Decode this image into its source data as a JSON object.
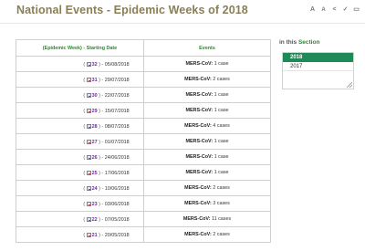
{
  "page": {
    "title": "National Events - Epidemic Weeks of 2018"
  },
  "toolbar": {
    "tools": [
      {
        "icon": "increase-font-icon",
        "glyph": "A"
      },
      {
        "icon": "decrease-font-icon",
        "glyph": "A"
      },
      {
        "icon": "share-icon",
        "glyph": "<"
      },
      {
        "icon": "send-icon",
        "glyph": "✓"
      },
      {
        "icon": "print-icon",
        "glyph": "▭"
      }
    ]
  },
  "table": {
    "headers": {
      "week": "(Epidemic Week) - Starting Date",
      "events": "Events"
    },
    "rows": [
      {
        "week": "32",
        "date": "05/08/2018",
        "event_name": "MERS-CoV",
        "event_count": "1 case"
      },
      {
        "week": "31",
        "date": "29/07/2018",
        "event_name": "MERS-CoV",
        "event_count": "2 cases"
      },
      {
        "week": "30",
        "date": "22/07/2018",
        "event_name": "MERS-CoV",
        "event_count": "1 case"
      },
      {
        "week": "29",
        "date": "15/07/2018",
        "event_name": "MERS-CoV",
        "event_count": "1 case"
      },
      {
        "week": "28",
        "date": "08/07/2018",
        "event_name": "MERS-CoV",
        "event_count": "4 cases"
      },
      {
        "week": "27",
        "date": "01/07/2018",
        "event_name": "MERS-CoV",
        "event_count": "1 case"
      },
      {
        "week": "26",
        "date": "24/06/2018",
        "event_name": "MERS-CoV",
        "event_count": "1 case"
      },
      {
        "week": "25",
        "date": "17/06/2018",
        "event_name": "MERS-CoV",
        "event_count": "1 case"
      },
      {
        "week": "24",
        "date": "10/06/2018",
        "event_name": "MERS-CoV",
        "event_count": "2 cases"
      },
      {
        "week": "23",
        "date": "03/06/2018",
        "event_name": "MERS-CoV",
        "event_count": "3 cases"
      },
      {
        "week": "22",
        "date": "07/05/2018",
        "event_name": "MERS-CoV",
        "event_count": "11 cases"
      },
      {
        "week": "21",
        "date": "20/05/2018",
        "event_name": "MERS-CoV",
        "event_count": "2 cases"
      }
    ]
  },
  "section": {
    "heading_prefix": "in this",
    "heading_accent": "Section",
    "years": [
      "2018",
      "2017"
    ],
    "selected_year": "2018"
  }
}
